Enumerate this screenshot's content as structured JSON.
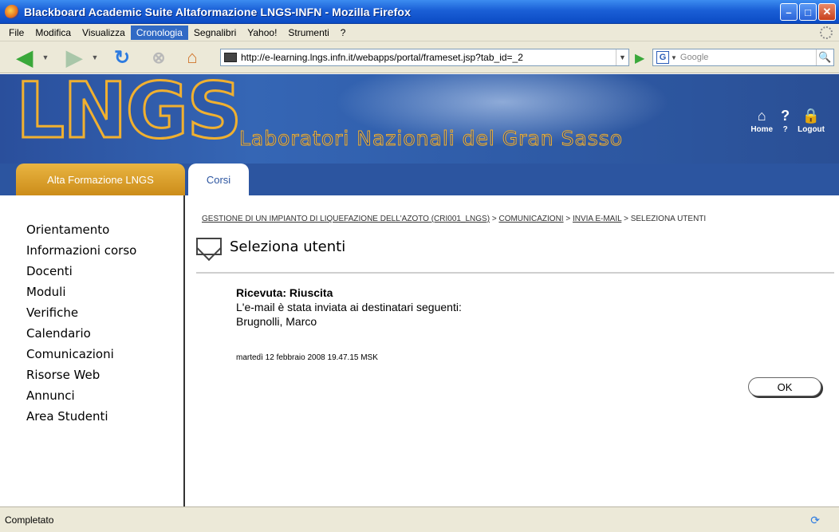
{
  "window": {
    "title": "Blackboard Academic Suite Altaformazione LNGS-INFN - Mozilla Firefox",
    "controls": [
      "minimize",
      "maximize",
      "close"
    ]
  },
  "menu": {
    "items": [
      {
        "label": "File"
      },
      {
        "label": "Modifica"
      },
      {
        "label": "Visualizza"
      },
      {
        "label": "Cronologia",
        "active": true
      },
      {
        "label": "Segnalibri"
      },
      {
        "label": "Yahoo!"
      },
      {
        "label": "Strumenti"
      },
      {
        "label": "?"
      }
    ]
  },
  "toolbar": {
    "url": "http://e-learning.lngs.infn.it/webapps/portal/frameset.jsp?tab_id=_2",
    "search_placeholder": "Google",
    "icons": [
      "back-icon",
      "forward-icon",
      "reload-icon",
      "stop-icon",
      "home-icon",
      "go-icon",
      "search-icon"
    ]
  },
  "banner": {
    "logo": "LNGS",
    "subtitle": "Laboratori Nazionali del Gran Sasso",
    "tools": [
      {
        "label": "Home",
        "icon": "home-icon"
      },
      {
        "label": "?",
        "icon": "help-icon"
      },
      {
        "label": "Logout",
        "icon": "lock-icon"
      }
    ]
  },
  "tabs": [
    {
      "label": "Alta Formazione LNGS"
    },
    {
      "label": "Corsi",
      "active": true
    }
  ],
  "sidebar": {
    "items": [
      {
        "label": "Orientamento"
      },
      {
        "label": "Informazioni corso"
      },
      {
        "label": "Docenti"
      },
      {
        "label": "Moduli"
      },
      {
        "label": "Verifiche"
      },
      {
        "label": "Calendario"
      },
      {
        "label": "Comunicazioni"
      },
      {
        "label": "Risorse Web"
      },
      {
        "label": "Annunci"
      },
      {
        "label": "Area Studenti"
      }
    ]
  },
  "main": {
    "breadcrumb": [
      "GESTIONE DI UN IMPIANTO DI LIQUEFAZIONE DELL'AZOTO (CRI001_LNGS)",
      "COMUNICAZIONI",
      "INVIA E-MAIL",
      "SELEZIONA UTENTI"
    ],
    "separator": ">",
    "page_title": "Seleziona utenti",
    "receipt_label": "Ricevuta: Riuscita",
    "message": "L'e-mail è stata inviata ai destinatari seguenti:",
    "recipient": "Brugnolli, Marco",
    "timestamp": "martedì 12 febbraio 2008 19.47.15 MSK",
    "ok_label": "OK"
  },
  "status": {
    "text": "Completato"
  }
}
